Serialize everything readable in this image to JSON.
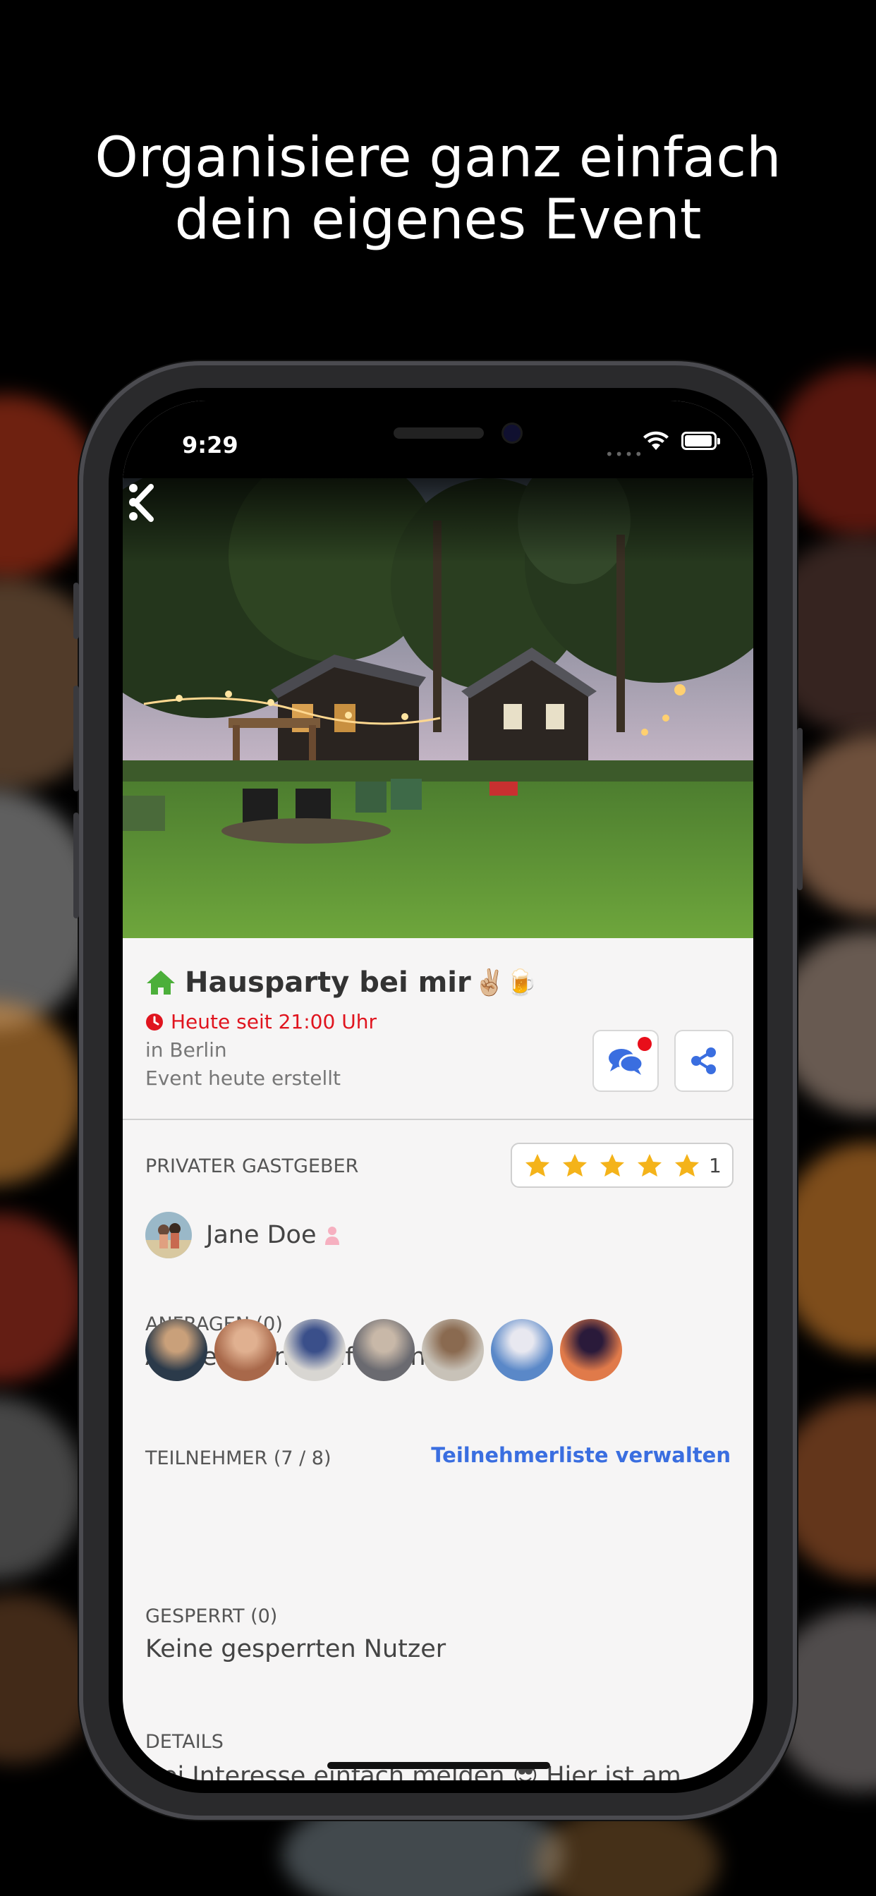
{
  "headline": {
    "line1": "Organisiere ganz einfach",
    "line2": "dein eigenes Event"
  },
  "status_bar": {
    "time": "9:29"
  },
  "event": {
    "title": "Hausparty bei mir",
    "title_emoji": "✌🏼🍺",
    "time": "Heute seit 21:00 Uhr",
    "location": "in Berlin",
    "created": "Event heute erstellt"
  },
  "host": {
    "label": "PRIVATER GASTGEBER",
    "name": "Jane Doe",
    "rating_stars": 5,
    "rating_count": "1"
  },
  "requests": {
    "label": "ANFRAGEN (0)",
    "text": "Aktuell keine Anfragen"
  },
  "participants": {
    "label": "TEILNEHMER (7 / 8)",
    "manage_link": "Teilnehmerliste verwalten",
    "avatars": [
      {
        "name": "participant-1",
        "color1": "#2b3a4a",
        "color2": "#c9a07a"
      },
      {
        "name": "participant-2",
        "color1": "#a8684a",
        "color2": "#e0b090"
      },
      {
        "name": "participant-3",
        "color1": "#d8d6d2",
        "color2": "#3a4f8a"
      },
      {
        "name": "participant-4",
        "color1": "#6a6a70",
        "color2": "#c8b8a8"
      },
      {
        "name": "participant-5",
        "color1": "#c8c2b8",
        "color2": "#8a6a50"
      },
      {
        "name": "participant-6",
        "color1": "#5a88c8",
        "color2": "#e8e8f0"
      },
      {
        "name": "participant-7",
        "color1": "#e07a4a",
        "color2": "#2a1a3a"
      }
    ]
  },
  "blocked": {
    "label": "GESPERRT (0)",
    "text": "Keine gesperrten Nutzer"
  },
  "details": {
    "label": "DETAILS",
    "text": "Bei Interesse einfach melden 😎 Hier ist am"
  },
  "colors": {
    "accent_blue": "#3a6ee0",
    "alert_red": "#e0141e",
    "home_green": "#4caf3a",
    "star_yellow": "#f4b31a"
  }
}
